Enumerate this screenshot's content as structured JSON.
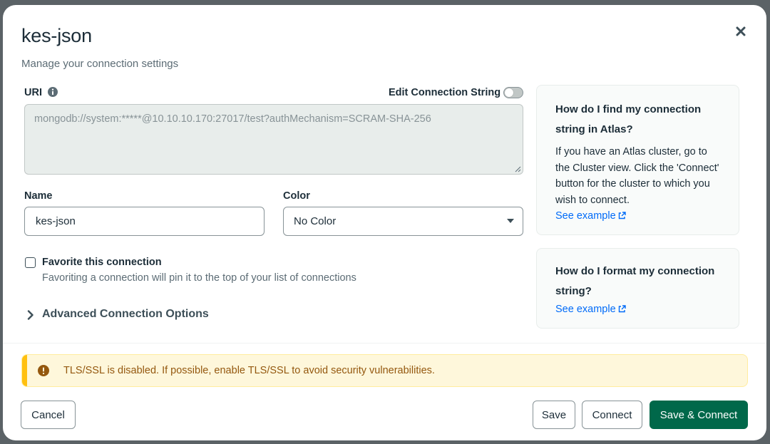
{
  "modal": {
    "title": "kes-json",
    "subtitle": "Manage your connection settings"
  },
  "uri": {
    "label": "URI",
    "edit_label": "Edit Connection String",
    "edit_enabled": false,
    "value": "mongodb://system:*****@10.10.10.170:27017/test?authMechanism=SCRAM-SHA-256"
  },
  "name": {
    "label": "Name",
    "value": "kes-json"
  },
  "color": {
    "label": "Color",
    "selected": "No Color"
  },
  "favorite": {
    "label": "Favorite this connection",
    "description": "Favoriting a connection will pin it to the top of your list of connections",
    "checked": false
  },
  "advanced": {
    "label": "Advanced Connection Options"
  },
  "help": [
    {
      "title": "How do I find my connection string in Atlas?",
      "body": "If you have an Atlas cluster, go to the Cluster view. Click the 'Connect' button for the cluster to which you wish to connect.",
      "link": "See example"
    },
    {
      "title": "How do I format my connection string?",
      "link": "See example"
    }
  ],
  "banner": {
    "text": "TLS/SSL is disabled. If possible, enable TLS/SSL to avoid security vulnerabilities."
  },
  "footer": {
    "cancel": "Cancel",
    "save": "Save",
    "connect": "Connect",
    "save_connect": "Save & Connect"
  },
  "colors": {
    "primary": "#00684a",
    "link": "#016bf8",
    "warning_bar": "#ffc010",
    "warning_bg": "#fef7db",
    "warning_text": "#94580f"
  }
}
